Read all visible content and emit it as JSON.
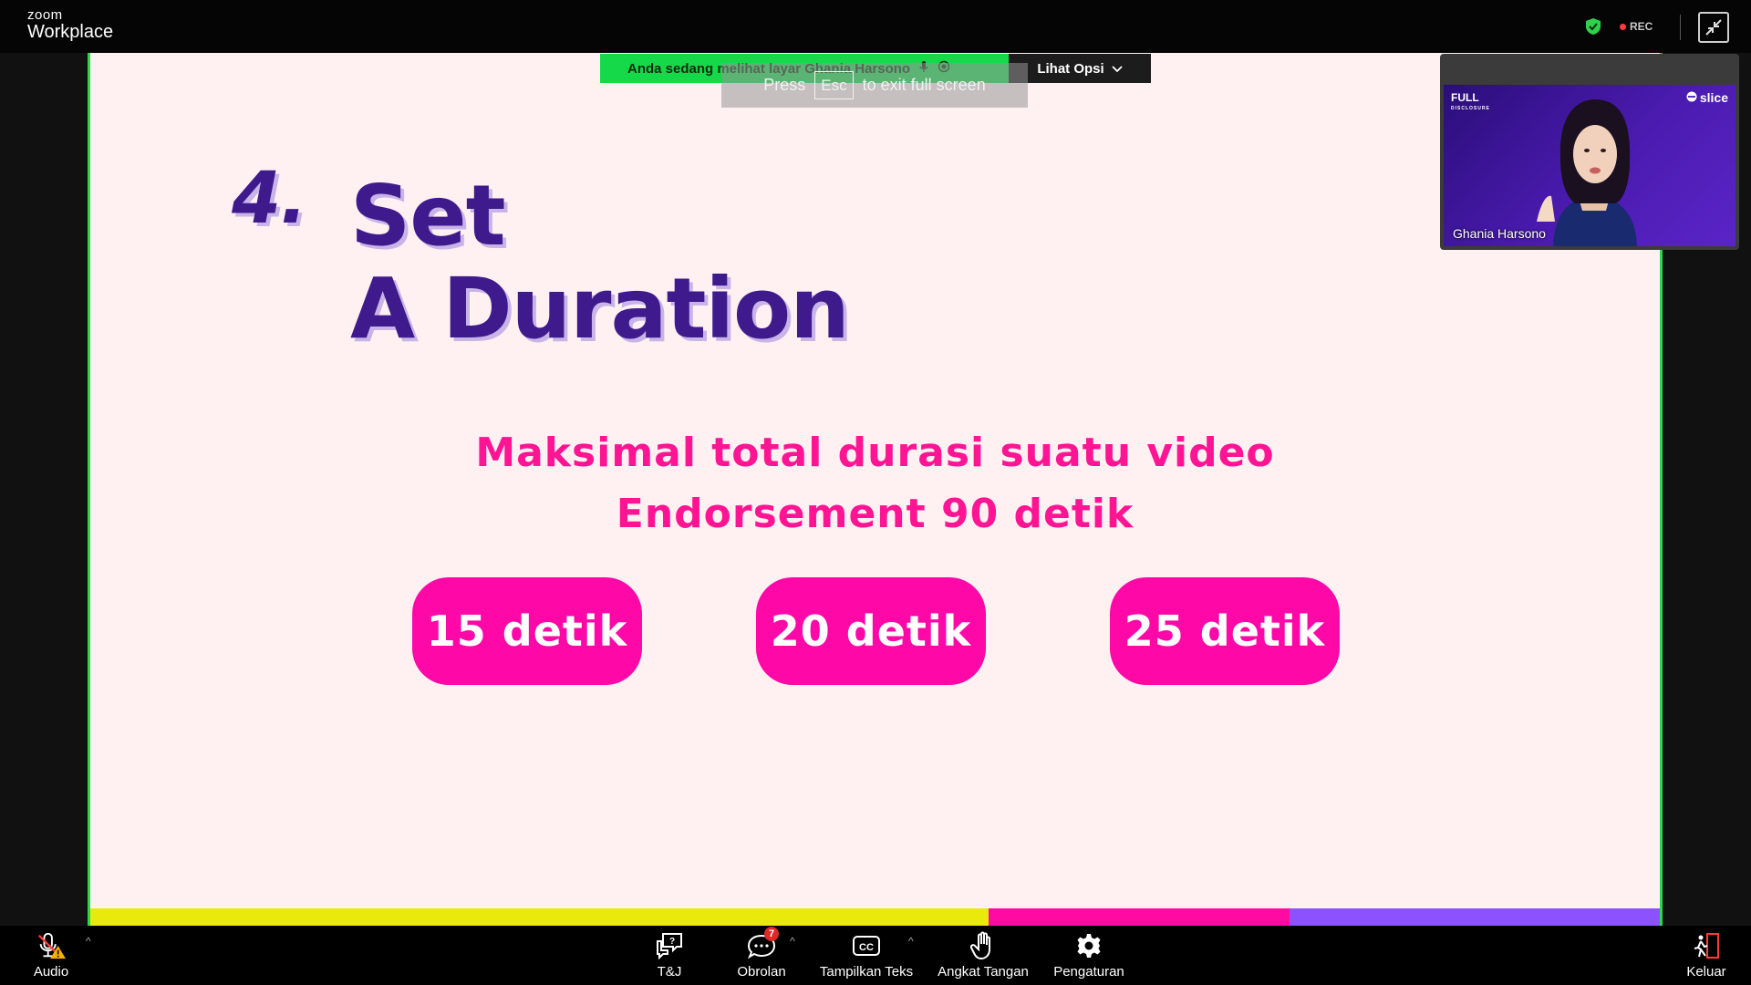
{
  "app": {
    "brand_small": "zoom",
    "brand_name": "Workplace",
    "rec_label": "REC"
  },
  "share_banner": {
    "text": "Anda sedang melihat layar Ghania Harsono",
    "view_options_label": "Lihat Opsi"
  },
  "esc_toast": {
    "press": "Press",
    "key": "Esc",
    "rest": "to exit full screen"
  },
  "slide": {
    "number": "4.",
    "title_line1": "Set",
    "title_line2": "A Duration",
    "desc_line1": "Maksimal total durasi suatu video",
    "desc_line2": "Endorsement 90 detik",
    "options": [
      "15 detik",
      "20 detik",
      "25 detik"
    ],
    "colors": {
      "title": "#3e1a8c",
      "accent": "#ff08a8",
      "stripe_yellow": "#e9ea0b",
      "stripe_pink": "#ff0aa3",
      "stripe_violet": "#8d52ff",
      "background": "#fff1f1"
    }
  },
  "video": {
    "participant_name": "Ghania Harsono",
    "logo_left": "FULL",
    "logo_left_sub": "DISCLOSURE",
    "logo_right": "slice"
  },
  "toolbar": {
    "audio_label": "Audio",
    "qa_label": "T&J",
    "chat_label": "Obrolan",
    "chat_badge": "7",
    "captions_label": "Tampilkan Teks",
    "raise_hand_label": "Angkat Tangan",
    "settings_label": "Pengaturan",
    "leave_label": "Keluar"
  },
  "icons": {
    "security": "shield-check-icon",
    "exit_fullscreen": "minimize-icon",
    "audio": "microphone-muted-warning-icon",
    "qa": "qa-chat-icon",
    "chat": "chat-bubble-icon",
    "captions": "cc-icon",
    "raise_hand": "hand-icon",
    "settings": "gear-icon",
    "leave": "exit-door-icon"
  }
}
